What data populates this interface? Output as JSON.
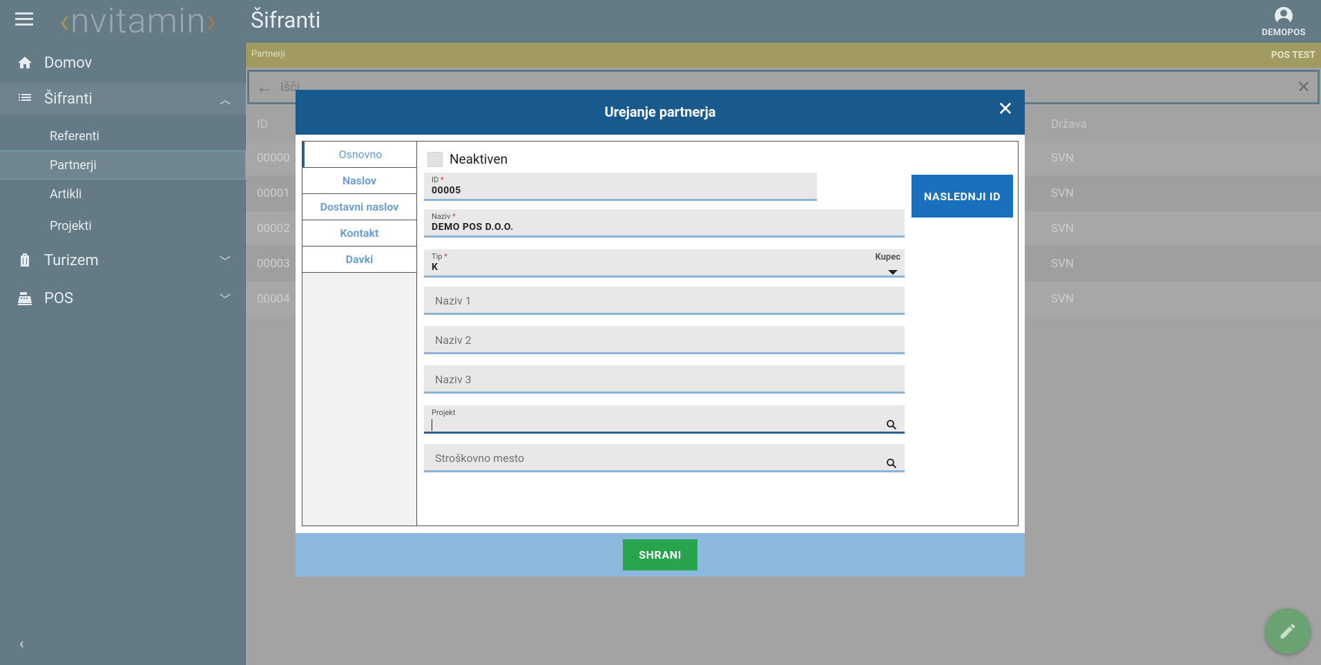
{
  "app": {
    "logo_text": "nvitamin",
    "title": "Šifranti",
    "user": "DEMOPOS"
  },
  "sidebar": {
    "items": [
      {
        "label": "Domov",
        "icon": "home-icon"
      },
      {
        "label": "Šifranti",
        "icon": "list-icon",
        "expanded": true
      },
      {
        "label": "Turizem",
        "icon": "luggage-icon"
      },
      {
        "label": "POS",
        "icon": "cash-register-icon"
      }
    ],
    "sub_items": [
      {
        "label": "Referenti"
      },
      {
        "label": "Partnerji",
        "active": true
      },
      {
        "label": "Artikli"
      },
      {
        "label": "Projekti"
      }
    ]
  },
  "breadcrumb": {
    "current": "Partnerji",
    "env_label": "POS TEST"
  },
  "search": {
    "placeholder": "Išči"
  },
  "grid": {
    "columns": [
      "ID",
      "Država"
    ],
    "rows": [
      {
        "id": "00000",
        "country": "SVN"
      },
      {
        "id": "00001",
        "country": "SVN"
      },
      {
        "id": "00002",
        "country": "SVN"
      },
      {
        "id": "00003",
        "country": "SVN"
      },
      {
        "id": "00004",
        "country": "SVN"
      }
    ]
  },
  "modal": {
    "title": "Urejanje partnerja",
    "tabs": [
      "Osnovno",
      "Naslov",
      "Dostavni naslov",
      "Kontakt",
      "Davki"
    ],
    "active_tab": "Osnovno",
    "inactive_label": "Neaktiven",
    "id_field": {
      "label": "ID",
      "value": "00005"
    },
    "next_id_button": "NASLEDNJI ID",
    "naziv_field": {
      "label": "Naziv",
      "value": "DEMO POS D.O.O."
    },
    "tip_field": {
      "label": "Tip",
      "value": "K",
      "display": "Kupec"
    },
    "naziv1_placeholder": "Naziv 1",
    "naziv2_placeholder": "Naziv 2",
    "naziv3_placeholder": "Naziv 3",
    "projekt_field": {
      "label": "Projekt",
      "value": ""
    },
    "strosek_placeholder": "Stroškovno mesto",
    "save_button": "SHRANI"
  },
  "colors": {
    "modal_header": "#195a8e",
    "next_id_button": "#1a70bd",
    "save_button": "#28a44c",
    "footer": "#8cb8de"
  }
}
